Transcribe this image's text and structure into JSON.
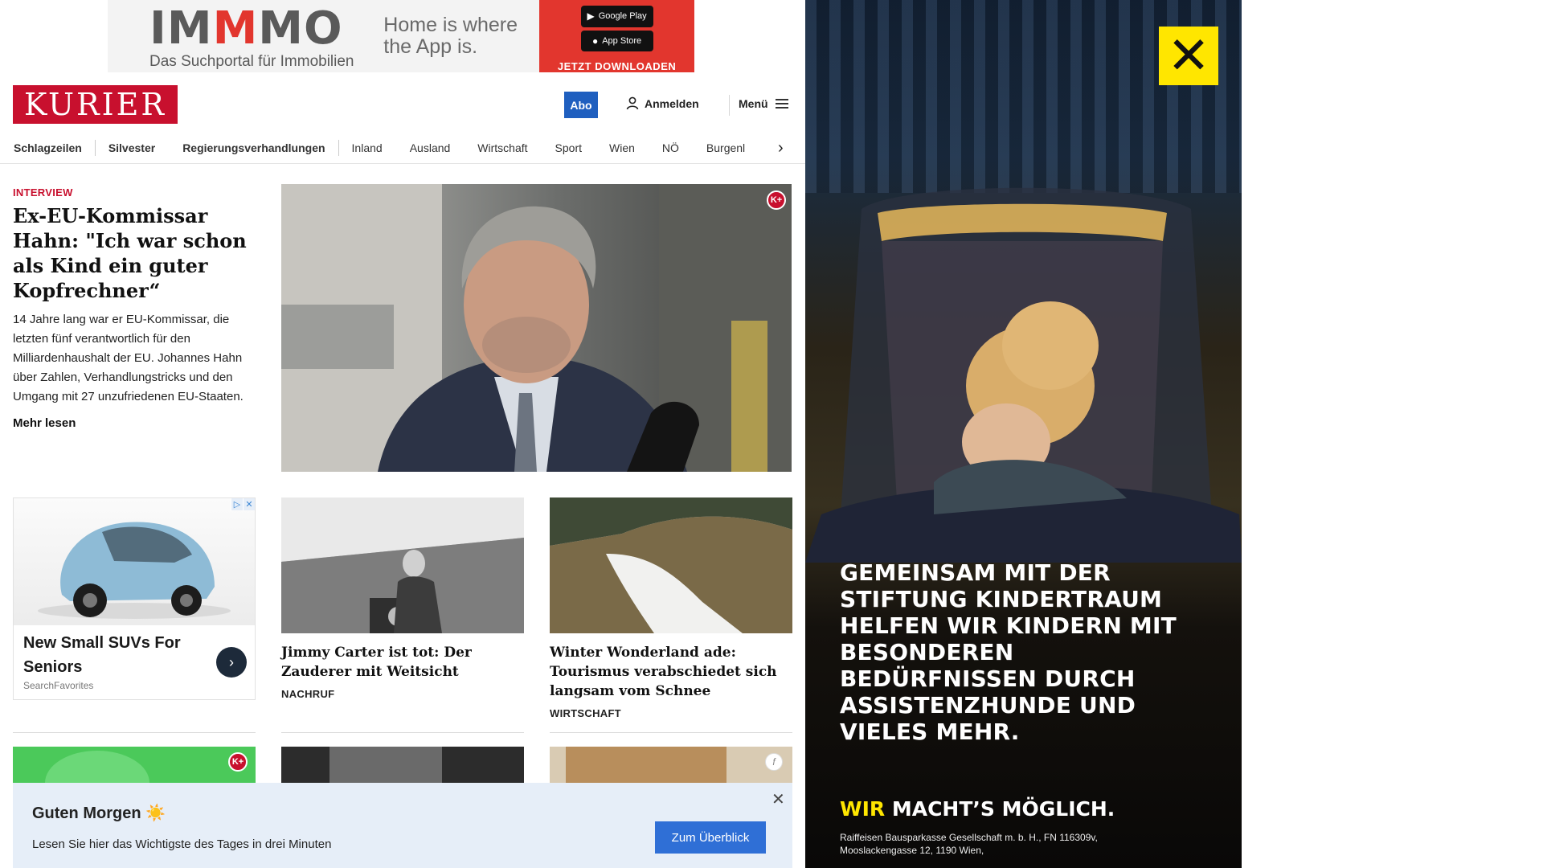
{
  "top_ad": {
    "brand": "IMMMO",
    "brand_sub": "Das Suchportal für Immobilien",
    "slogan": "Home is where the App is.",
    "google_play": "Google Play",
    "app_store": "App Store",
    "download_label": "JETZT DOWNLOADEN"
  },
  "header": {
    "logo": "KURIER",
    "abo_label": "Abo",
    "login_label": "Anmelden",
    "menu_label": "Menü"
  },
  "nav": {
    "items": [
      "Schlagzeilen",
      "Silvester",
      "Regierungsverhandlungen",
      "Inland",
      "Ausland",
      "Wirtschaft",
      "Sport",
      "Wien",
      "NÖ",
      "Burgenl"
    ]
  },
  "lead": {
    "kicker": "INTERVIEW",
    "title": "Ex-EU-Kommissar Hahn: \"Ich war schon als Kind ein guter Kopfrechner“",
    "description": "14 Jahre lang war er EU-Kommissar, die letzten fünf verantwortlich für den Milliardenhaushalt der EU. Johannes Hahn über Zahlen, Verhandlungstricks und den Umgang mit 27 unzufriedenen EU-Staaten.",
    "more_label": "Mehr lesen",
    "badge": "K+"
  },
  "ad_card": {
    "title": "New Small SUVs For Seniors",
    "source": "SearchFavorites",
    "flag_1": "▷",
    "flag_2": "✕"
  },
  "cards": [
    {
      "title": "Jimmy Carter ist tot: Der Zauderer mit Weitsicht",
      "tag": "NACHRUF"
    },
    {
      "title": "Winter Wonderland ade: Touris­mus verabschiedet sich langsam vom Schnee",
      "tag": "WIRTSCHAFT"
    }
  ],
  "row2_badges": {
    "kplus": "K+",
    "footnote": "f"
  },
  "notice": {
    "title": "Guten Morgen",
    "icon": "☀️",
    "text": "Lesen Sie hier das Wichtigste des Tages in drei Minuten",
    "button": "Zum Überblick",
    "close": "✕"
  },
  "sky_ad": {
    "headline": "GEMEINSAM MIT DER STIFTUNG KINDERTRAUM HELFEN WIR KINDERN MIT BESONDEREN BEDÜRFNISSEN DURCH ASSISTENZHUNDE UND VIELES MEHR.",
    "claim_highlight": "WIR",
    "claim_rest": "MACHT’S MÖGLICH.",
    "fineprint": "Raiffeisen Bausparkasse Gesellschaft m. b. H., FN 116309v, Mooslackengasse 12, 1190 Wien,"
  },
  "colors": {
    "kurier_red": "#c8102e",
    "abo_blue": "#1f5fbf",
    "notice_bg": "#e6eef8",
    "raiffeisen_yellow": "#ffe600"
  }
}
